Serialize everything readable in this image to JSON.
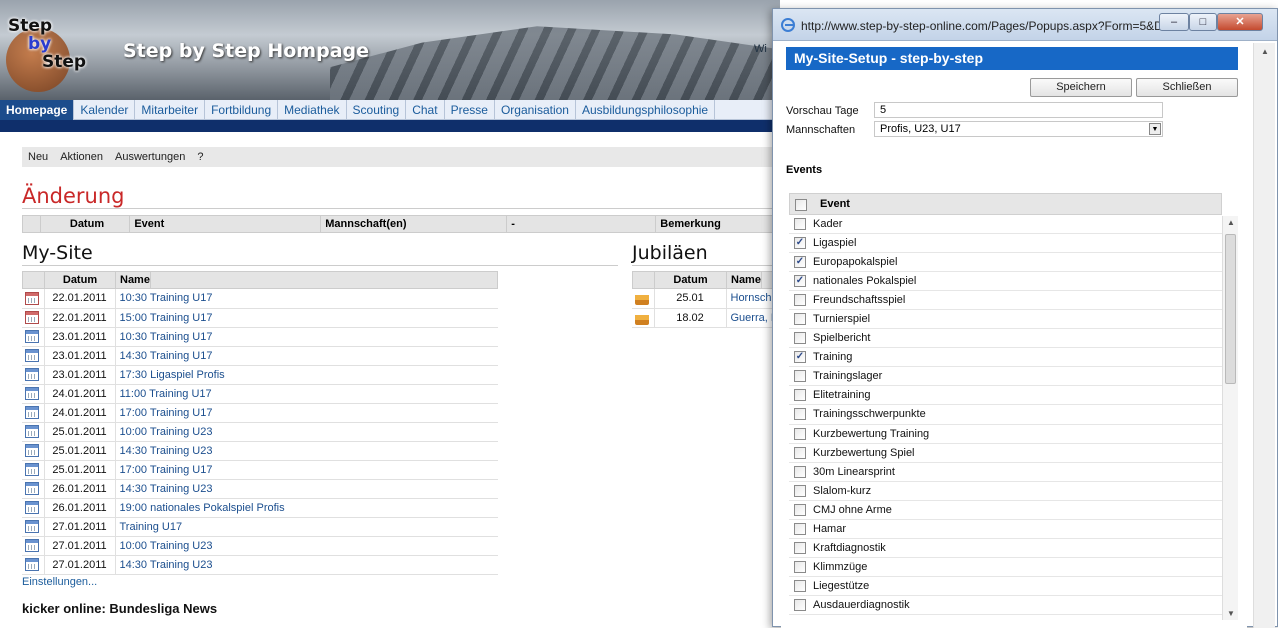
{
  "site": {
    "logo": {
      "line1": "Step",
      "line2": "by",
      "line3": "Step"
    },
    "title": "Step by Step Hompage",
    "header_fragment": "Wi",
    "nav": [
      {
        "label": "Homepage",
        "active": true
      },
      {
        "label": "Kalender"
      },
      {
        "label": "Mitarbeiter"
      },
      {
        "label": "Fortbildung"
      },
      {
        "label": "Mediathek"
      },
      {
        "label": "Scouting"
      },
      {
        "label": "Chat"
      },
      {
        "label": "Presse"
      },
      {
        "label": "Organisation"
      },
      {
        "label": "Ausbildungsphilosophie"
      }
    ],
    "actions": [
      "Neu",
      "Aktionen",
      "Auswertungen",
      "?"
    ]
  },
  "aenderung": {
    "title": "Änderung",
    "columns": [
      "Datum",
      "Event",
      "Mannschaft(en)",
      "-",
      "Bemerkung"
    ]
  },
  "mysite": {
    "title": "My-Site",
    "columns": [
      "Datum",
      "Name"
    ],
    "rows": [
      {
        "icon": "calendar-red",
        "date": "22.01.2011",
        "name": "10:30 Training U17"
      },
      {
        "icon": "calendar-red",
        "date": "22.01.2011",
        "name": "15:00 Training U17"
      },
      {
        "icon": "calendar",
        "date": "23.01.2011",
        "name": "10:30 Training U17"
      },
      {
        "icon": "calendar",
        "date": "23.01.2011",
        "name": "14:30 Training U17"
      },
      {
        "icon": "calendar",
        "date": "23.01.2011",
        "name": "17:30 Ligaspiel Profis"
      },
      {
        "icon": "calendar",
        "date": "24.01.2011",
        "name": "11:00 Training U17"
      },
      {
        "icon": "calendar",
        "date": "24.01.2011",
        "name": "17:00 Training U17"
      },
      {
        "icon": "calendar",
        "date": "25.01.2011",
        "name": "10:00 Training U23"
      },
      {
        "icon": "calendar",
        "date": "25.01.2011",
        "name": "14:30 Training U23"
      },
      {
        "icon": "calendar",
        "date": "25.01.2011",
        "name": "17:00 Training U17"
      },
      {
        "icon": "calendar",
        "date": "26.01.2011",
        "name": "14:30 Training U23"
      },
      {
        "icon": "calendar",
        "date": "26.01.2011",
        "name": "19:00 nationales Pokalspiel Profis"
      },
      {
        "icon": "calendar",
        "date": "27.01.2011",
        "name": "Training U17"
      },
      {
        "icon": "calendar",
        "date": "27.01.2011",
        "name": "10:00 Training U23"
      },
      {
        "icon": "calendar",
        "date": "27.01.2011",
        "name": "14:30 Training U23"
      }
    ],
    "settings_link": "Einstellungen..."
  },
  "jubilaeen": {
    "title": "Jubiläen",
    "columns": [
      "Datum",
      "Name"
    ],
    "rows": [
      {
        "icon": "cake",
        "date": "25.01",
        "name": "Hornschu"
      },
      {
        "icon": "cake",
        "date": "18.02",
        "name": "Guerra, F"
      }
    ]
  },
  "kicker": "kicker online: Bundesliga News",
  "popup": {
    "url": "http://www.step-by-step-online.com/Pages/Popups.aspx?Form=5&D...",
    "window_buttons": {
      "minimize": "–",
      "maximize": "□",
      "close": "✕"
    },
    "header": "My-Site-Setup - step-by-step",
    "save": "Speichern",
    "close": "Schließen",
    "preview_label": "Vorschau Tage",
    "preview_value": "5",
    "teams_label": "Mannschaften",
    "teams_value": "Profis, U23, U17",
    "events_label": "Events",
    "events_header": "Event",
    "events": [
      {
        "name": "Kader",
        "checked": false
      },
      {
        "name": "Ligaspiel",
        "checked": true
      },
      {
        "name": "Europapokalspiel",
        "checked": true
      },
      {
        "name": "nationales Pokalspiel",
        "checked": true
      },
      {
        "name": "Freundschaftsspiel",
        "checked": false
      },
      {
        "name": "Turnierspiel",
        "checked": false
      },
      {
        "name": "Spielbericht",
        "checked": false
      },
      {
        "name": "Training",
        "checked": true
      },
      {
        "name": "Trainingslager",
        "checked": false
      },
      {
        "name": "Elitetraining",
        "checked": false
      },
      {
        "name": "Trainingsschwerpunkte",
        "checked": false
      },
      {
        "name": "Kurzbewertung Training",
        "checked": false
      },
      {
        "name": "Kurzbewertung Spiel",
        "checked": false
      },
      {
        "name": "30m Linearsprint",
        "checked": false
      },
      {
        "name": "Slalom-kurz",
        "checked": false
      },
      {
        "name": "CMJ ohne Arme",
        "checked": false
      },
      {
        "name": "Hamar",
        "checked": false
      },
      {
        "name": "Kraftdiagnostik",
        "checked": false
      },
      {
        "name": "Klimmzüge",
        "checked": false
      },
      {
        "name": "Liegestütze",
        "checked": false
      },
      {
        "name": "Ausdauerdiagnostik",
        "checked": false
      }
    ]
  }
}
